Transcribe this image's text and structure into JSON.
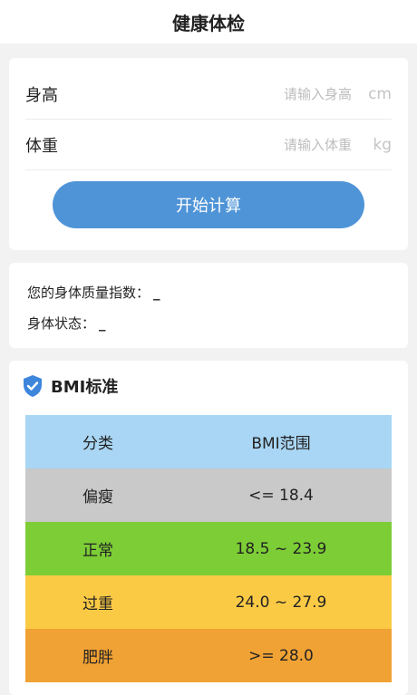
{
  "header": {
    "title": "健康体检"
  },
  "form": {
    "height": {
      "label": "身高",
      "placeholder": "请输入身高",
      "unit": "cm"
    },
    "weight": {
      "label": "体重",
      "placeholder": "请输入体重",
      "unit": "kg"
    },
    "calc_label": "开始计算"
  },
  "result": {
    "bmi_label": "您的身体质量指数：",
    "bmi_value": "_",
    "status_label": "身体状态：",
    "status_value": "_"
  },
  "bmi": {
    "title": "BMI标准",
    "icon": "shield-check-icon",
    "table": {
      "header": {
        "category": "分类",
        "range": "BMI范围",
        "color": "#a9d6f4"
      },
      "rows": [
        {
          "category": "偏瘦",
          "range": "<= 18.4",
          "color": "#c9c9c9"
        },
        {
          "category": "正常",
          "range": "18.5 ~ 23.9",
          "color": "#7ccd36"
        },
        {
          "category": "过重",
          "range": "24.0 ~ 27.9",
          "color": "#fbca45"
        },
        {
          "category": "肥胖",
          "range": ">= 28.0",
          "color": "#f1a234"
        }
      ]
    }
  },
  "colors": {
    "accent": "#4f94d7",
    "shield": "#3d86dc",
    "background": "#f2f2f2"
  }
}
